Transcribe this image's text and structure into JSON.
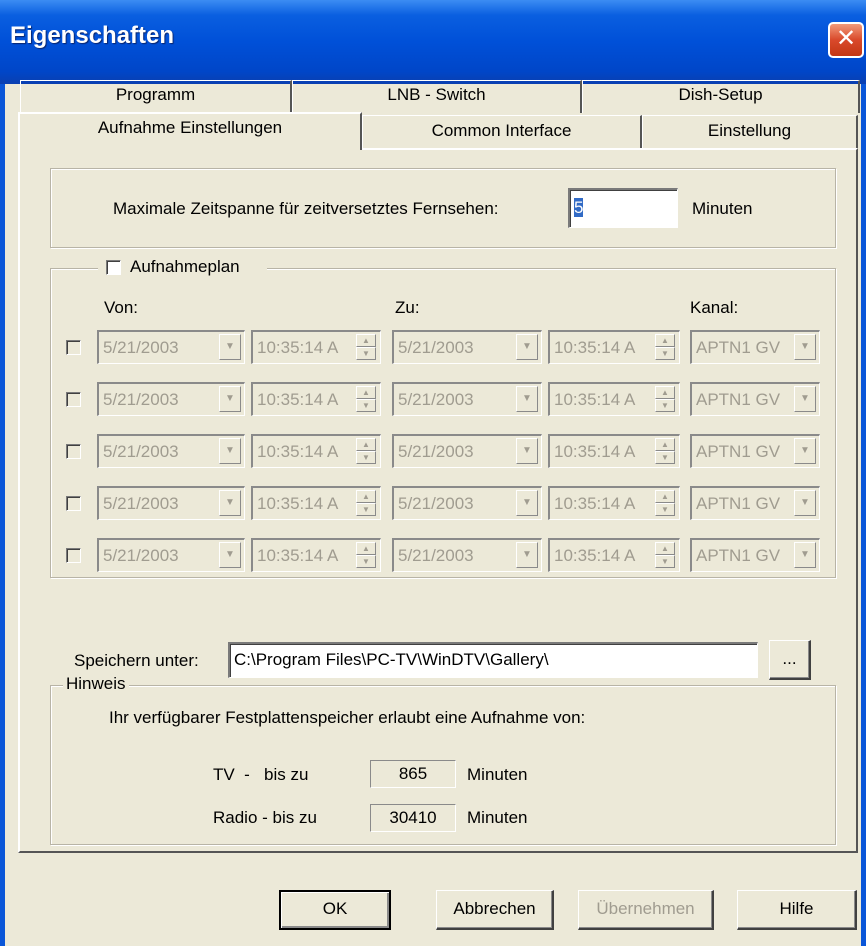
{
  "window": {
    "title": "Eigenschaften",
    "close_glyph": "✕"
  },
  "tabs": {
    "row_back": [
      "Programm",
      "LNB - Switch",
      "Dish-Setup"
    ],
    "row_front": [
      "Aufnahme Einstellungen",
      "Common Interface",
      "Einstellung"
    ],
    "selected": "Aufnahme Einstellungen"
  },
  "timeshift": {
    "label": "Maximale Zeitspanne für zeitversetztes Fernsehen:",
    "value": "5",
    "unit": "Minuten"
  },
  "schedule": {
    "checkbox_label": "Aufnahmeplan",
    "checked": false,
    "col_from": "Von:",
    "col_to": "Zu:",
    "col_channel": "Kanal:",
    "rows": [
      {
        "from_date": "5/21/2003",
        "from_time": "10:35:14 A",
        "to_date": "5/21/2003",
        "to_time": "10:35:14 A",
        "channel": "APTN1 GV"
      },
      {
        "from_date": "5/21/2003",
        "from_time": "10:35:14 A",
        "to_date": "5/21/2003",
        "to_time": "10:35:14 A",
        "channel": "APTN1 GV"
      },
      {
        "from_date": "5/21/2003",
        "from_time": "10:35:14 A",
        "to_date": "5/21/2003",
        "to_time": "10:35:14 A",
        "channel": "APTN1 GV"
      },
      {
        "from_date": "5/21/2003",
        "from_time": "10:35:14 A",
        "to_date": "5/21/2003",
        "to_time": "10:35:14 A",
        "channel": "APTN1 GV"
      },
      {
        "from_date": "5/21/2003",
        "from_time": "10:35:14 A",
        "to_date": "5/21/2003",
        "to_time": "10:35:14 A",
        "channel": "APTN1 GV"
      }
    ]
  },
  "save": {
    "label": "Speichern unter:",
    "path": "C:\\Program Files\\PC-TV\\WinDTV\\Gallery\\",
    "browse_label": "..."
  },
  "hint": {
    "legend": "Hinweis",
    "text": "Ihr verfügbarer Festplattenspeicher erlaubt eine Aufnahme von:",
    "tv_label": "TV  -   bis zu",
    "tv_value": "865",
    "radio_label": "Radio - bis zu",
    "radio_value": "30410",
    "unit": "Minuten"
  },
  "buttons": {
    "ok": "OK",
    "cancel": "Abbrechen",
    "apply": "Übernehmen",
    "help": "Hilfe"
  },
  "colors": {
    "title_bar": "#0050d8",
    "dialog_bg": "#ece9d8",
    "selection": "#316ac5",
    "disabled_text": "#a09c90"
  }
}
